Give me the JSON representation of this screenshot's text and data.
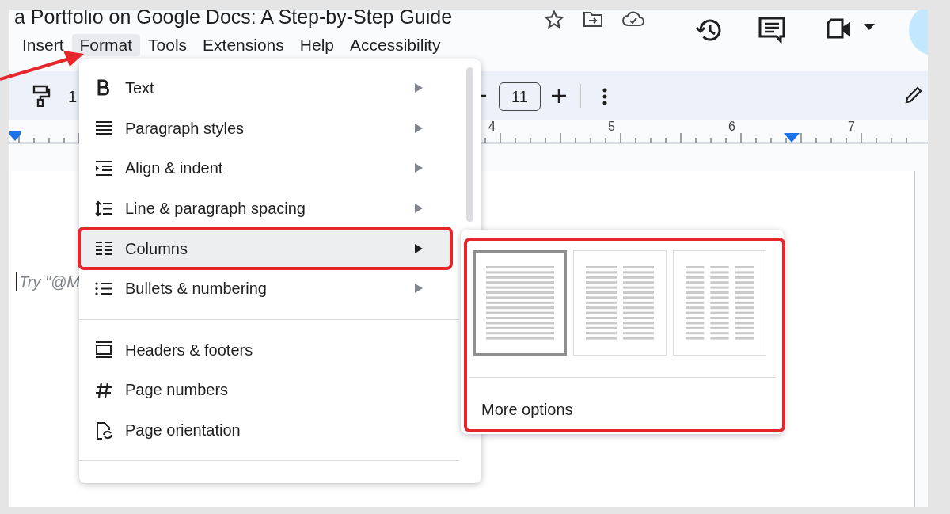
{
  "document": {
    "title": "a Portfolio on Google Docs: A Step-by-Step Guide"
  },
  "menu_bar": [
    {
      "label": "Insert",
      "selected": false
    },
    {
      "label": "Format",
      "selected": true
    },
    {
      "label": "Tools",
      "selected": false
    },
    {
      "label": "Extensions",
      "selected": false
    },
    {
      "label": "Help",
      "selected": false
    },
    {
      "label": "Accessibility",
      "selected": false
    }
  ],
  "toolbar": {
    "cut_text": "1",
    "font_size": "11"
  },
  "ruler": {
    "numbers": [
      "4",
      "5",
      "6",
      "7"
    ]
  },
  "page": {
    "placeholder": "Try \"@M"
  },
  "format_menu": {
    "groups": [
      [
        {
          "label": "Text",
          "has_submenu": true,
          "highlighted": false,
          "annotated": false
        },
        {
          "label": "Paragraph styles",
          "has_submenu": true,
          "highlighted": false,
          "annotated": false
        },
        {
          "label": "Align & indent",
          "has_submenu": true,
          "highlighted": false,
          "annotated": false
        },
        {
          "label": "Line & paragraph spacing",
          "has_submenu": true,
          "highlighted": false,
          "annotated": false
        },
        {
          "label": "Columns",
          "has_submenu": true,
          "highlighted": true,
          "annotated": true
        },
        {
          "label": "Bullets & numbering",
          "has_submenu": true,
          "highlighted": false,
          "annotated": false
        }
      ],
      [
        {
          "label": "Headers & footers",
          "has_submenu": false,
          "highlighted": false,
          "annotated": false
        },
        {
          "label": "Page numbers",
          "has_submenu": false,
          "highlighted": false,
          "annotated": false
        },
        {
          "label": "Page orientation",
          "has_submenu": false,
          "highlighted": false,
          "annotated": false
        }
      ]
    ]
  },
  "columns_submenu": {
    "annotated": true,
    "options": [
      {
        "selected": true
      },
      {
        "selected": false
      },
      {
        "selected": false
      }
    ],
    "more_options": "More options"
  }
}
